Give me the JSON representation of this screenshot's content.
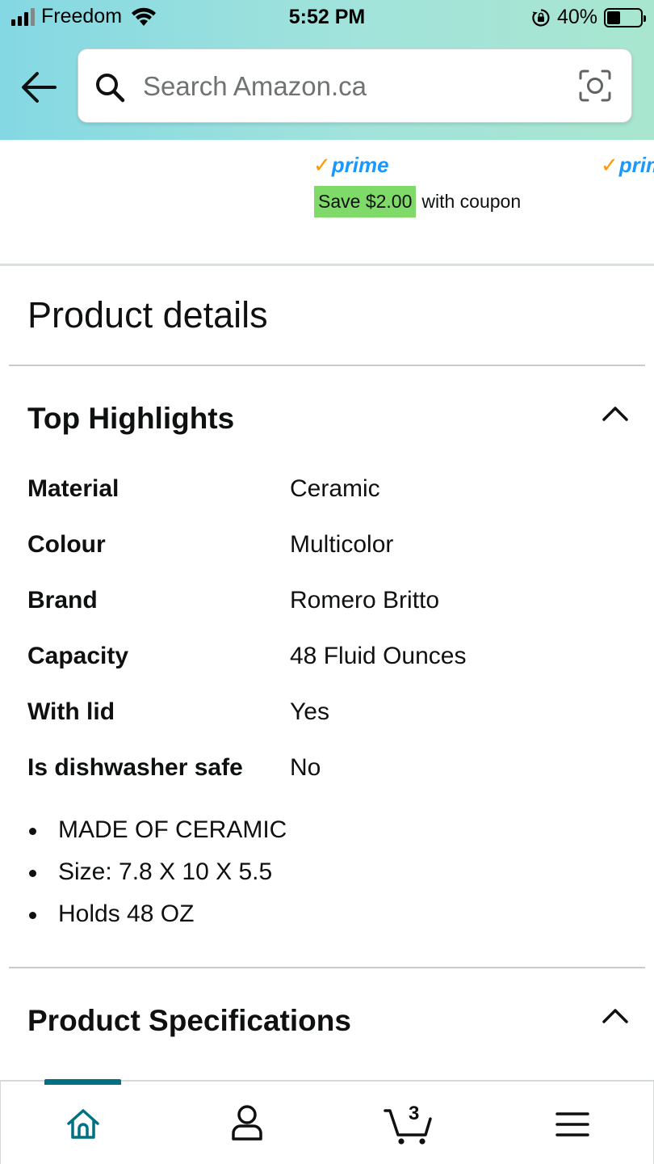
{
  "status_bar": {
    "carrier": "Freedom",
    "time": "5:52 PM",
    "battery_percent": "40%",
    "battery_level": 0.4,
    "signal_bars_active": 3,
    "icons": [
      "signal-icon",
      "wifi-icon",
      "rotation-lock-icon",
      "battery-icon"
    ]
  },
  "header": {
    "back_icon": "back-arrow-icon",
    "search_placeholder": "Search Amazon.ca",
    "search_value": "",
    "search_icon": "search-icon",
    "camera_icon": "camera-search-icon"
  },
  "product_strip": {
    "prime_check": "✓",
    "prime_label": "prime",
    "prime_label_cut": "prim",
    "coupon_badge": "Save $2.00",
    "coupon_text": "with coupon"
  },
  "product_details": {
    "title": "Product details",
    "top_highlights": {
      "heading": "Top Highlights",
      "expanded": true,
      "rows": [
        {
          "label": "Material",
          "value": "Ceramic"
        },
        {
          "label": "Colour",
          "value": "Multicolor"
        },
        {
          "label": "Brand",
          "value": "Romero Britto"
        },
        {
          "label": "Capacity",
          "value": "48 Fluid Ounces"
        },
        {
          "label": "With lid",
          "value": "Yes"
        },
        {
          "label": "Is dishwasher safe",
          "value": "No"
        }
      ],
      "bullets": [
        "MADE OF CERAMIC",
        "Size: 7.8 X 10 X 5.5",
        "Holds 48 OZ"
      ]
    },
    "product_specifications": {
      "heading": "Product Specifications",
      "expanded": true
    }
  },
  "tab_bar": {
    "active": "home",
    "cart_count": "3",
    "icons": [
      "home-icon",
      "account-icon",
      "cart-icon",
      "menu-icon"
    ]
  },
  "colors": {
    "header_gradient_start": "#84d8e3",
    "header_gradient_end": "#a8e6cf",
    "prime_blue": "#1a98ff",
    "prime_check_orange": "#ff9900",
    "coupon_green": "#7fda69",
    "active_tab": "#007185"
  }
}
